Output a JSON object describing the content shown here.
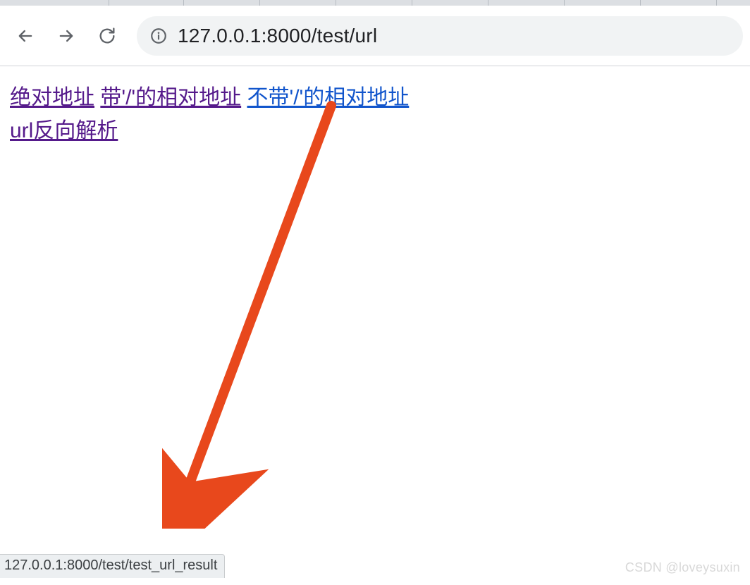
{
  "toolbar": {
    "url": "127.0.0.1:8000/test/url"
  },
  "links": {
    "absolute": "绝对地址",
    "relative_with_slash": "带'/'的相对地址",
    "relative_without_slash": "不带'/'的相对地址",
    "reverse": "url反向解析"
  },
  "status_bar": {
    "text": "127.0.0.1:8000/test/test_url_result"
  },
  "watermark": {
    "text": "CSDN @loveysuxin"
  }
}
